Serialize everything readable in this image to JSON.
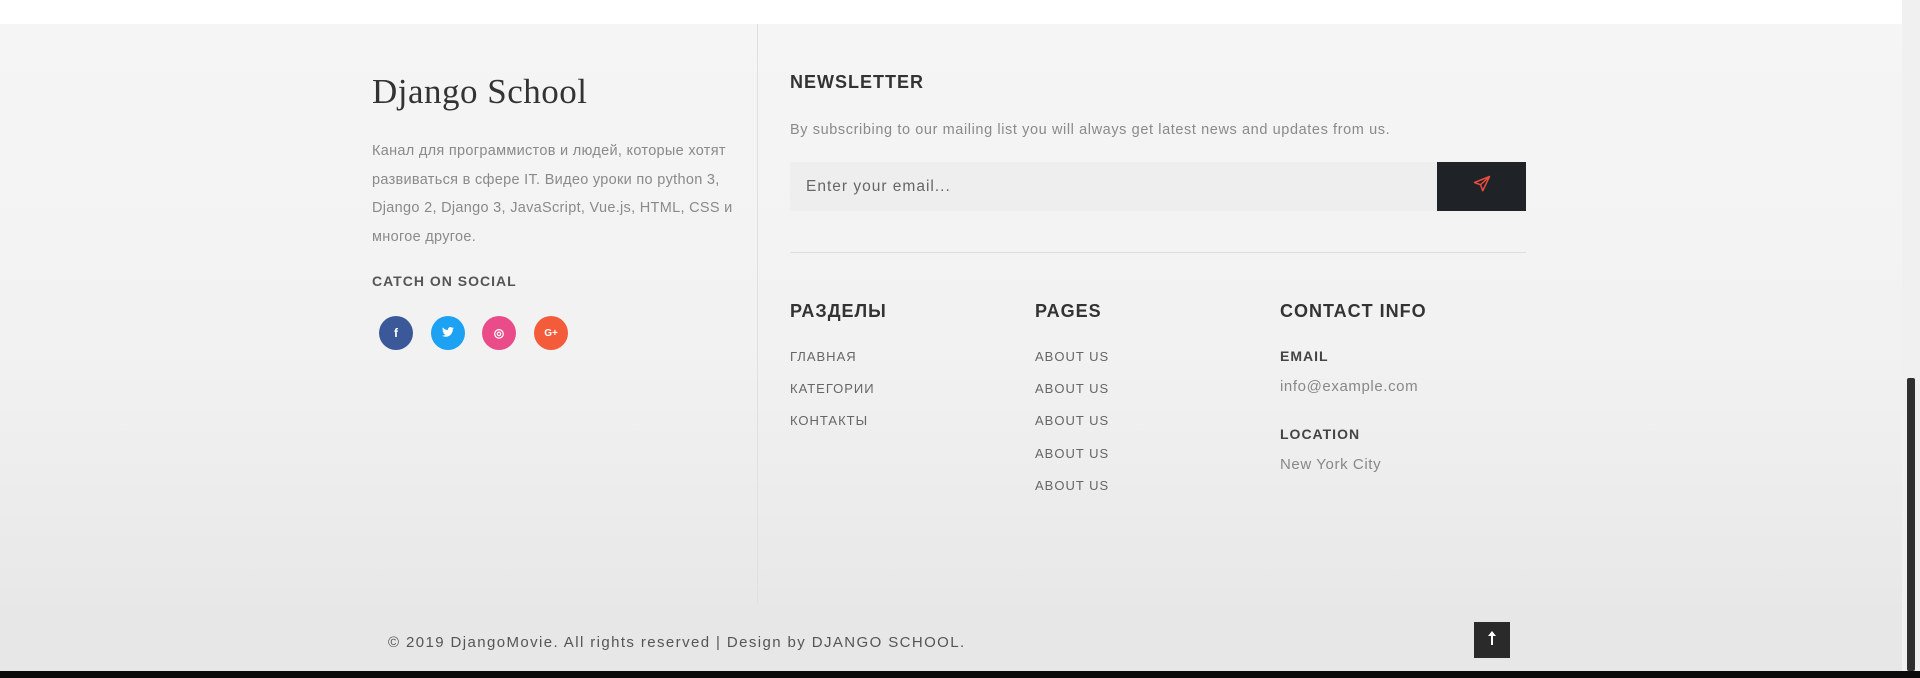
{
  "brand": {
    "title": "Django School"
  },
  "about": {
    "description": "Канал для программистов и людей, которые хотят развиваться в сфере IT. Видео уроки по python 3, Django 2, Django 3, JavaScript, Vue.js, HTML, CSS и многое другое."
  },
  "social": {
    "title": "CATCH ON SOCIAL",
    "links": [
      {
        "icon": "facebook-icon",
        "glyph": "f",
        "color": "#3b5998"
      },
      {
        "icon": "twitter-icon",
        "glyph": "t",
        "color": "#1da1f2"
      },
      {
        "icon": "dribbble-icon",
        "glyph": "◎",
        "color": "#ea4c89"
      },
      {
        "icon": "google-plus-icon",
        "glyph": "G+",
        "color": "#f35b3b"
      }
    ]
  },
  "newsletter": {
    "title": "NEWSLETTER",
    "text": "By subscribing to our mailing list you will always get latest news and updates from us.",
    "input": {
      "placeholder": "Enter your email...",
      "value": ""
    },
    "button_icon": "paper-plane-icon",
    "accent_color": "#e74c3c"
  },
  "sections": {
    "title": "РАЗДЕЛЫ",
    "items": [
      "ГЛАВНАЯ",
      "КАТЕГОРИИ",
      "КОНТАКТЫ"
    ]
  },
  "pages": {
    "title": "PAGES",
    "items": [
      "ABOUT US",
      "ABOUT US",
      "ABOUT US",
      "ABOUT US",
      "ABOUT US"
    ]
  },
  "contact": {
    "title": "CONTACT INFO",
    "email_label": "EMAIL",
    "email_value": "info@example.com",
    "location_label": "LOCATION",
    "location_value": "New York City"
  },
  "footer": {
    "copyright": "© 2019 DjangoMovie. All rights reserved | Design by DJANGO SCHOOL.",
    "to_top_icon": "arrow-up-icon"
  }
}
